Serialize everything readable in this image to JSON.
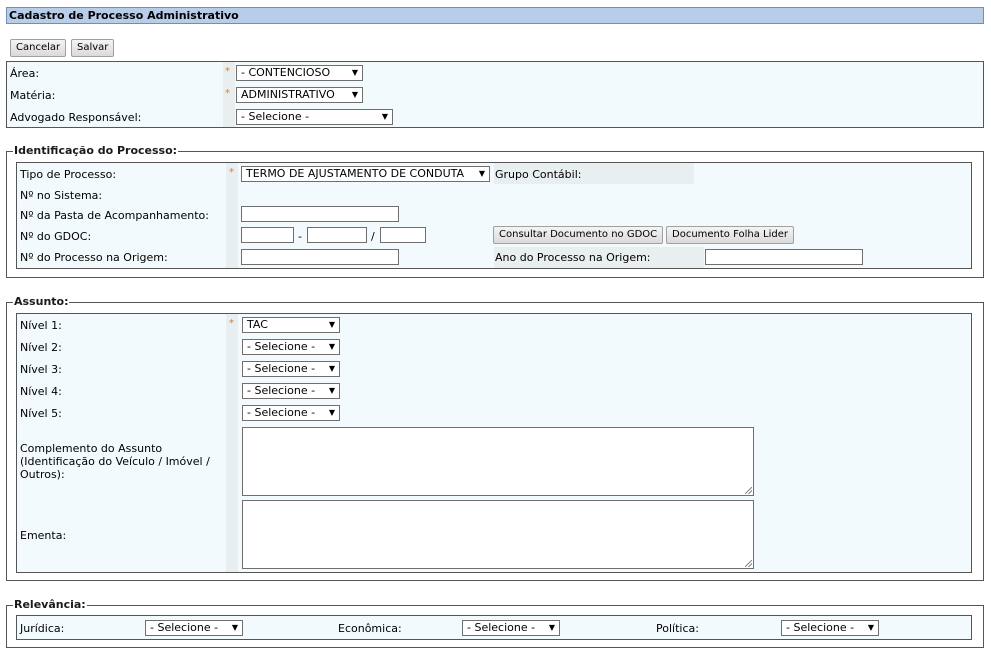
{
  "page": {
    "title": "Cadastro de Processo Administrativo",
    "cancel_label": "Cancelar",
    "save_label": "Salvar"
  },
  "top": {
    "area_label": "Área:",
    "area_value": "- CONTENCIOSO",
    "materia_label": "Matéria:",
    "materia_value": "ADMINISTRATIVO",
    "advogado_label": "Advogado Responsável:",
    "advogado_value": "- Selecione -"
  },
  "identificacao": {
    "legend": "Identificação do Processo:",
    "tipo_label": "Tipo de Processo:",
    "tipo_value": "TERMO DE AJUSTAMENTO DE CONDUTA",
    "grupo_label": "Grupo Contábil:",
    "sistema_label": "Nº no Sistema:",
    "pasta_label": "Nº da Pasta de Acompanhamento:",
    "gdoc_label": "Nº do GDOC:",
    "gdoc_sep1": "-",
    "gdoc_sep2": "/",
    "consultar_label": "Consultar Documento no GDOC",
    "folha_label": "Documento Folha Lider",
    "origem_label": "Nº do Processo na Origem:",
    "ano_label": "Ano do Processo na Origem:"
  },
  "assunto": {
    "legend": "Assunto:",
    "nivel1_label": "Nível 1:",
    "nivel1_value": "TAC",
    "nivel2_label": "Nível 2:",
    "nivel2_value": "- Selecione -",
    "nivel3_label": "Nível 3:",
    "nivel3_value": "- Selecione -",
    "nivel4_label": "Nível 4:",
    "nivel4_value": "- Selecione -",
    "nivel5_label": "Nível 5:",
    "nivel5_value": "- Selecione -",
    "complemento_label_l1": "Complemento do Assunto",
    "complemento_label_l2": "(Identificação do Veículo / Imóvel /",
    "complemento_label_l3": "Outros):",
    "ementa_label": "Ementa:"
  },
  "relevancia": {
    "legend": "Relevância:",
    "juridica_label": "Jurídica:",
    "juridica_value": "- Selecione -",
    "economica_label": "Econômica:",
    "economica_value": "- Selecione -",
    "politica_label": "Política:",
    "politica_value": "- Selecione -"
  },
  "icons": {
    "dropdown": "▼",
    "required": "*"
  },
  "colors": {
    "title_bg": "#b7cde9",
    "row_bg": "#f3fafd",
    "required": "#e07b1e"
  }
}
